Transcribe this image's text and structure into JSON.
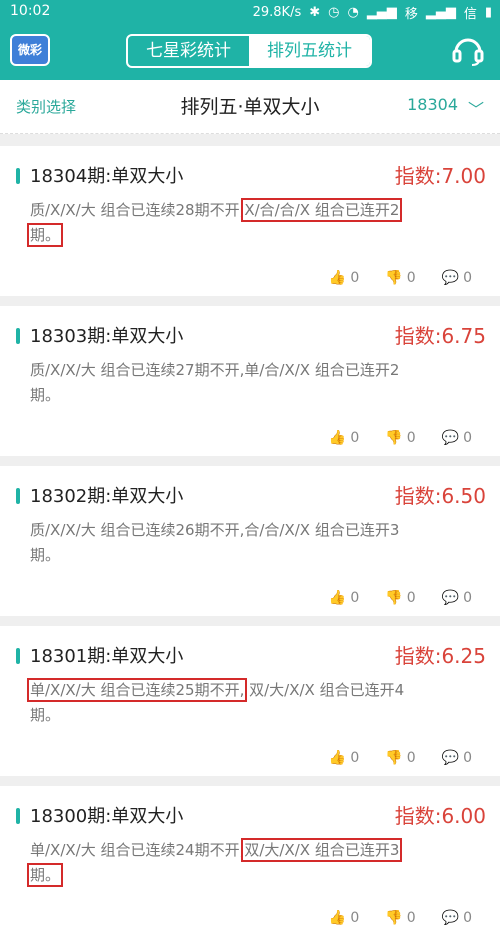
{
  "status": {
    "time": "10:02",
    "speed": "29.8K/s",
    "carrier": "移",
    "carrier2": "信"
  },
  "app": {
    "logo": "微彩",
    "tabs": [
      {
        "label": "七星彩统计",
        "active": false
      },
      {
        "label": "排列五统计",
        "active": true
      }
    ]
  },
  "filter": {
    "left": "类别选择",
    "title": "排列五·单双大小",
    "issue": "18304",
    "chevron": "﹀"
  },
  "cards": [
    {
      "title": "18304期:单双大小",
      "index": "指数:7.00",
      "text_a": "质/X/X/大 组合已连续28期不开,",
      "text_b": "X/合/合/X 组合已连开2",
      "text_c": "期。",
      "likes": "0",
      "dislikes": "0",
      "comments": "0"
    },
    {
      "title": "18303期:单双大小",
      "index": "指数:6.75",
      "text_a": "质/X/X/大 组合已连续27期不开,",
      "text_b": "单/合/X/X 组合已连开2",
      "text_c": "期。",
      "likes": "0",
      "dislikes": "0",
      "comments": "0"
    },
    {
      "title": "18302期:单双大小",
      "index": "指数:6.50",
      "text_a": "质/X/X/大 组合已连续26期不开,",
      "text_b": "合/合/X/X 组合已连开3",
      "text_c": "期。",
      "likes": "0",
      "dislikes": "0",
      "comments": "0"
    },
    {
      "title": "18301期:单双大小",
      "index": "指数:6.25",
      "text_a": "单/X/X/大 组合已连续25期不开,",
      "text_b": "双/大/X/X 组合已连开4",
      "text_c": "期。",
      "likes": "0",
      "dislikes": "0",
      "comments": "0"
    },
    {
      "title": "18300期:单双大小",
      "index": "指数:6.00",
      "text_a": "单/X/X/大 组合已连续24期不开,",
      "text_b": "双/大/X/X 组合已连开3",
      "text_c": "期。",
      "likes": "0",
      "dislikes": "0",
      "comments": "0"
    }
  ]
}
